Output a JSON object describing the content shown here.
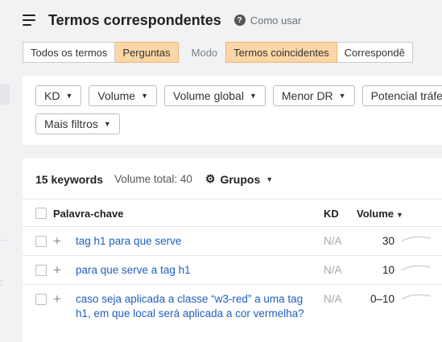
{
  "header": {
    "title": "Termos correspondentes",
    "help_label": "Como usar"
  },
  "modebar": {
    "tabs": [
      "Todos os termos",
      "Perguntas"
    ],
    "active_tab": "Perguntas",
    "mode_label": "Modo",
    "modes": [
      "Termos coincidentes",
      "Correspondê"
    ],
    "active_mode": "Termos coincidentes"
  },
  "filters": {
    "row1": [
      "KD",
      "Volume",
      "Volume global",
      "Menor DR",
      "Potencial tráfeg"
    ],
    "more": "Mais filtros"
  },
  "summary": {
    "count": "15 keywords",
    "volume_total": "Volume total: 40",
    "groups": "Grupos"
  },
  "table": {
    "headers": {
      "keyword": "Palavra-chave",
      "kd": "KD",
      "volume": "Volume"
    },
    "rows": [
      {
        "keyword": "tag h1 para que serve",
        "kd": "N/A",
        "volume": "30"
      },
      {
        "keyword": "para que serve a tag h1",
        "kd": "N/A",
        "volume": "10"
      },
      {
        "keyword": "caso seja aplicada a classe “w3-red” a uma tag h1, em que local será aplicada a cor vermelha?",
        "kd": "N/A",
        "volume": "0–10"
      }
    ]
  },
  "colors": {
    "accent_orange": "#fcd6a6",
    "link_blue": "#1f5fbf"
  }
}
